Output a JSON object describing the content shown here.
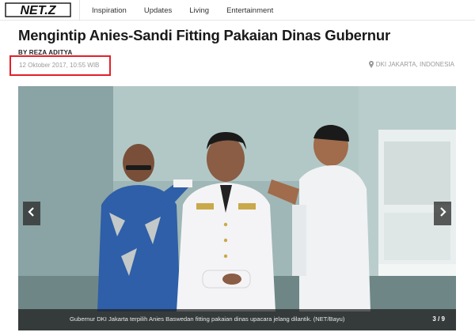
{
  "nav": {
    "logo_text": "NET.Z",
    "items": [
      {
        "label": "Inspiration"
      },
      {
        "label": "Updates"
      },
      {
        "label": "Living"
      },
      {
        "label": "Entertainment"
      }
    ]
  },
  "article": {
    "title": "Mengintip Anies-Sandi Fitting Pakaian Dinas Gubernur",
    "byline": "BY REZA ADITYA",
    "date": "12 Oktober 2017, 10:55 WIB",
    "location": "DKI JAKARTA, INDONESIA"
  },
  "gallery": {
    "caption": "Gubernur DKI Jakarta terpilih Anies Baswedan fitting pakaian dinas upacara jelang dilantik. (NET/Bayu)",
    "counter": "3 / 9",
    "prev_icon": "chevron-left-icon",
    "next_icon": "chevron-right-icon"
  },
  "colors": {
    "highlight": "#e3202a",
    "muted_text": "#9a9a9a"
  }
}
